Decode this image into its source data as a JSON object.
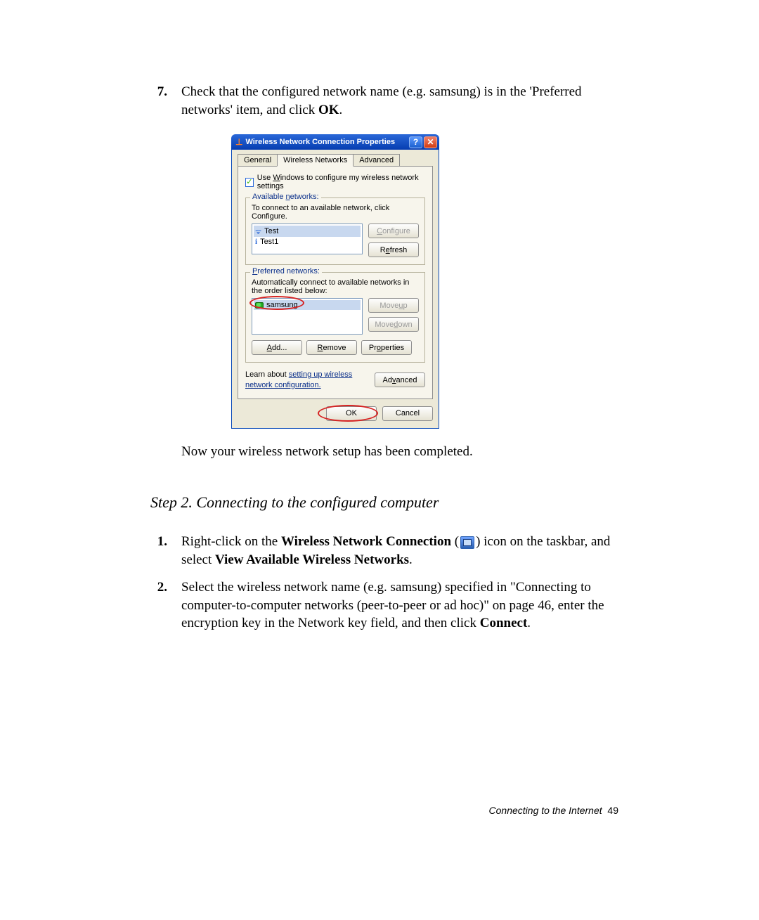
{
  "steps_top": {
    "num": "7.",
    "text_a": "Check that the configured network name (e.g. samsung) is in the 'Preferred networks' item, and click ",
    "ok": "OK",
    "period": "."
  },
  "dialog": {
    "title": "Wireless Network Connection Properties",
    "tabs": {
      "general": "General",
      "wireless": "Wireless Networks",
      "advanced": "Advanced"
    },
    "use_windows_a": "Use ",
    "use_windows_u": "W",
    "use_windows_b": "indows to configure my wireless network settings",
    "available": {
      "legend_a": "Available ",
      "legend_u": "n",
      "legend_b": "etworks:",
      "note": "To connect to an available network, click Configure.",
      "items": [
        "Test",
        "Test1"
      ],
      "configure_u": "C",
      "configure_b": "onfigure",
      "refresh_a": "R",
      "refresh_u": "e",
      "refresh_b": "fresh"
    },
    "preferred": {
      "legend_u": "P",
      "legend_b": "referred networks:",
      "note": "Automatically connect to available networks in the order listed below:",
      "items": [
        "samsung"
      ],
      "moveup_a": "Move ",
      "moveup_u": "u",
      "moveup_b": "p",
      "movedown_a": "Move ",
      "movedown_u": "d",
      "movedown_b": "own",
      "add_u": "A",
      "add_b": "dd...",
      "remove_u": "R",
      "remove_b": "emove",
      "properties_a": "Pr",
      "properties_u": "o",
      "properties_b": "perties"
    },
    "learn_a": "Learn about ",
    "learn_link": "setting up wireless network configuration.",
    "advanced_btn_a": "Ad",
    "advanced_btn_u": "v",
    "advanced_btn_b": "anced",
    "ok": "OK",
    "cancel": "Cancel"
  },
  "after_note": "Now your wireless network setup has been completed.",
  "section_heading": "Step 2. Connecting to the configured computer",
  "steps_bottom": [
    {
      "num": "1.",
      "a": "Right-click on the ",
      "b_bold": "Wireless Network Connection",
      "c": " (",
      "d": ") icon on the taskbar, and select ",
      "e_bold": "View Available Wireless Networks",
      "f": "."
    },
    {
      "num": "2.",
      "a": "Select the wireless network name (e.g. samsung) specified in \"Connecting to computer-to-computer networks (peer-to-peer or ad hoc)\" on page 46, enter the encryption key in the Network key field, and then click ",
      "b_bold": "Connect",
      "c": "."
    }
  ],
  "footer": {
    "text": "Connecting to the Internet",
    "page": "49"
  }
}
